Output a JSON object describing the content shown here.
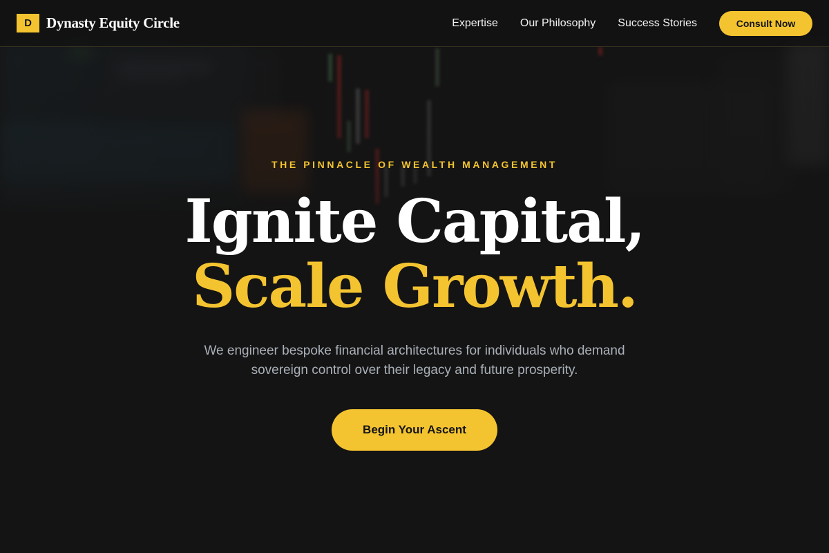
{
  "header": {
    "logo_mark": "D",
    "brand_name": "Dynasty Equity Circle",
    "nav": [
      {
        "label": "Expertise"
      },
      {
        "label": "Our Philosophy"
      },
      {
        "label": "Success Stories"
      }
    ],
    "cta_label": "Consult Now"
  },
  "hero": {
    "eyebrow": "THE PINNACLE OF WEALTH MANAGEMENT",
    "headline_line1": "Ignite Capital,",
    "headline_line2": "Scale Growth.",
    "subcopy": "We engineer bespoke financial architectures for individuals who demand sovereign control over their legacy and future prosperity.",
    "button_label": "Begin Your Ascent"
  },
  "colors": {
    "background": "#141414",
    "accent": "#f4c430",
    "text": "#ffffff",
    "muted_text": "#aab0b8"
  }
}
